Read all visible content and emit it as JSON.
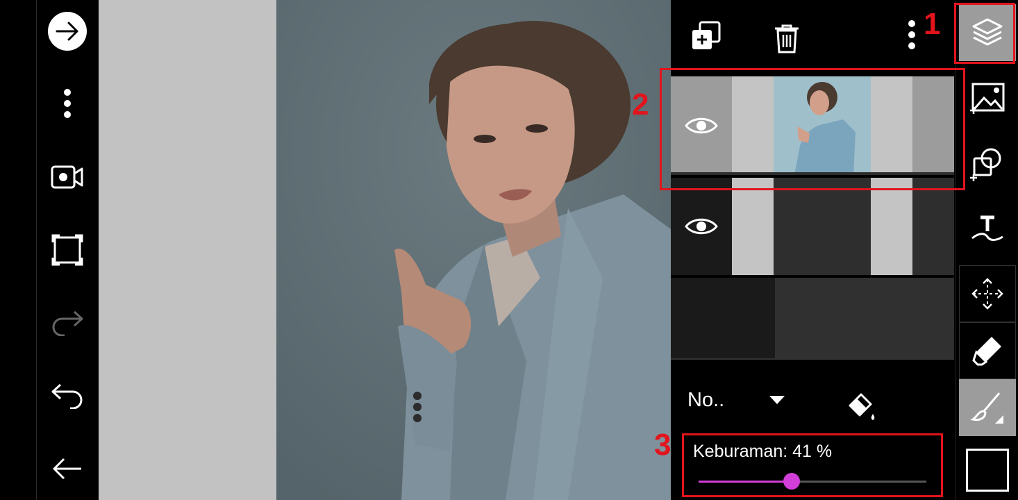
{
  "left_toolbar": {
    "items": [
      {
        "icon": "arrow-right-circle-icon"
      },
      {
        "icon": "more-vertical-icon"
      },
      {
        "icon": "video-record-icon"
      },
      {
        "icon": "crop-frame-icon"
      },
      {
        "icon": "redo-icon"
      },
      {
        "icon": "undo-icon"
      },
      {
        "icon": "back-arrow-icon"
      }
    ]
  },
  "layers_panel": {
    "toolbar": {
      "add_layer_icon": "add-layer-icon",
      "delete_icon": "trash-icon",
      "more_icon": "more-vertical-icon"
    },
    "blend_mode": "No..",
    "opacity": {
      "label": "Keburaman: 41 %",
      "value_percent": 41
    }
  },
  "annotations": {
    "labels": [
      "1",
      "2",
      "3"
    ],
    "color": "#e3141c"
  },
  "colors": {
    "accent": "#d23ed8",
    "panel_bg": "#000000",
    "layer_bg": "#2d2d2d",
    "selected_layer_bg": "#9c9c9c"
  }
}
